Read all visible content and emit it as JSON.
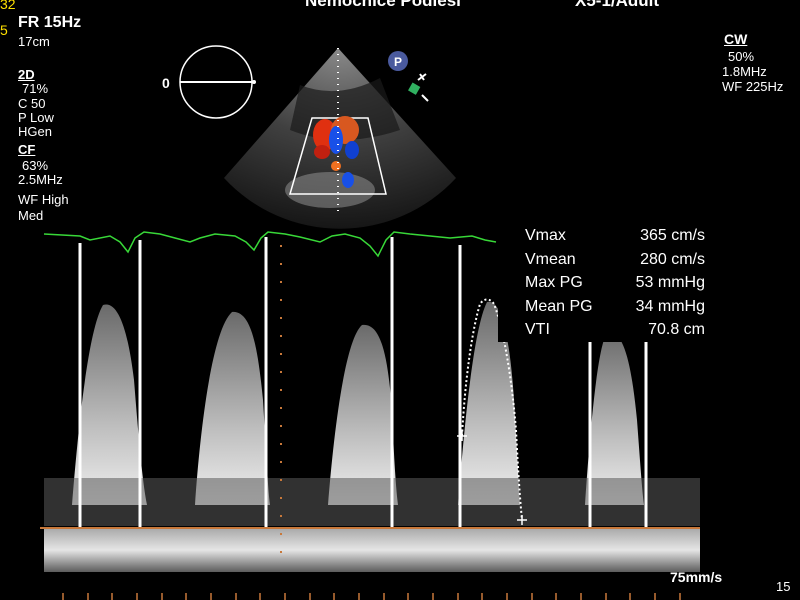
{
  "header": {
    "title_center": "Nemocnice Podlesí",
    "title_right": "X5-1/Adult",
    "corner_top": "32",
    "corner_mid": "5"
  },
  "left_panel": {
    "fr": "FR 15Hz",
    "depth": "17cm",
    "mode_2d": "2D",
    "gain_2d": "71%",
    "c": "C 50",
    "p": "P Low",
    "hgen": "HGen",
    "mode_cf": "CF",
    "gain_cf": "63%",
    "freq_cf": "2.5MHz",
    "wf": "WF High",
    "med": "Med"
  },
  "right_panel": {
    "mode_cw": "CW",
    "gain_cw": "50%",
    "freq_cw": "1.8MHz",
    "wf": "WF 225Hz"
  },
  "angle_indicator": {
    "label": "0"
  },
  "probe_badge": {
    "label": "P"
  },
  "measurements": [
    {
      "label": "Vmax",
      "value": "365 cm/s"
    },
    {
      "label": "Vmean",
      "value": "280 cm/s"
    },
    {
      "label": "Max PG",
      "value": "53 mmHg"
    },
    {
      "label": "Mean PG",
      "value": "34 mmHg"
    },
    {
      "label": "VTI",
      "value": "70.8 cm"
    }
  ],
  "sweep_speed": "75mm/s",
  "bottom_right": "15",
  "colors": {
    "ecg": "#38d838",
    "baseline": "#c8783a",
    "color_red": "#e03010",
    "color_blue": "#1850e8",
    "trace": "#ffffff"
  }
}
